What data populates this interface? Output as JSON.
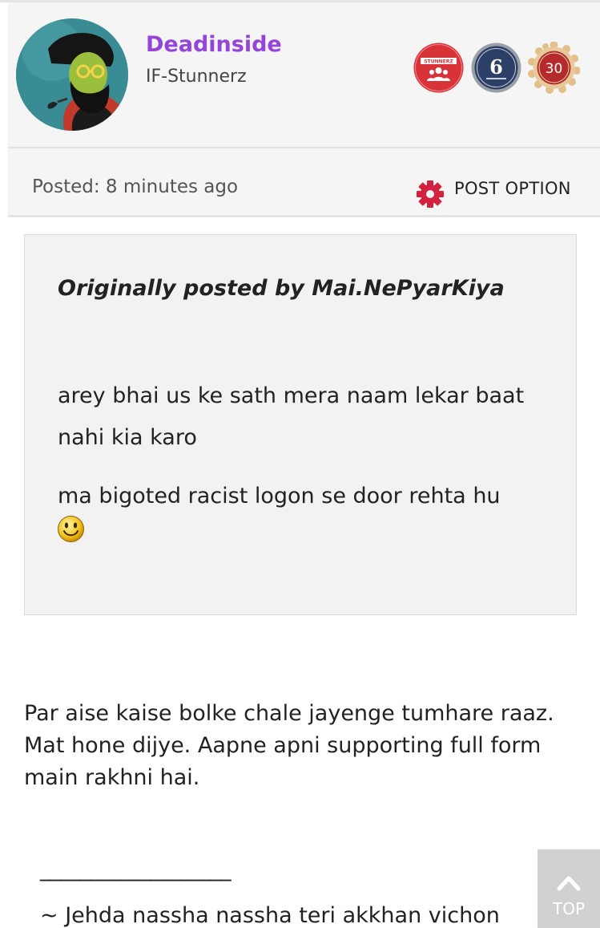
{
  "post": {
    "author": {
      "username": "Deadinside",
      "usergroup": "IF-Stunnerz",
      "avatar_icon": "bearded-man-cartoon-avatar"
    },
    "badges": [
      {
        "icon": "stunnerz-group-badge",
        "text": "STUNNERZ",
        "color": "#d9333a"
      },
      {
        "icon": "anniversary-6-badge",
        "text": "6",
        "color": "#2c3f66"
      },
      {
        "icon": "posts-30-medal-badge",
        "text": "30",
        "color": "#d8a85f"
      }
    ],
    "posted_time": "Posted: 8 minutes ago",
    "post_option_label": "POST OPTION",
    "quote": {
      "header": "Originally posted by Mai.NePyarKiya",
      "line1": "arey bhai us ke sath mera naam lekar baat nahi kia karo",
      "line2": "ma bigoted racist logon se door rehta hu",
      "emoji_icon": "smiley-icon"
    },
    "body": "Par aise kaise bolke chale jayenge tumhare raaz. Mat hone dijye. Aapne apni supporting full form main rakhni hai.",
    "signature": {
      "rule": "___________________",
      "line1": "~ Jehda nassha nassha teri akkhan vichon"
    }
  },
  "ui": {
    "scroll_top_label": "TOP",
    "accent_color": "#9444d8",
    "gear_color": "#d3223f"
  }
}
